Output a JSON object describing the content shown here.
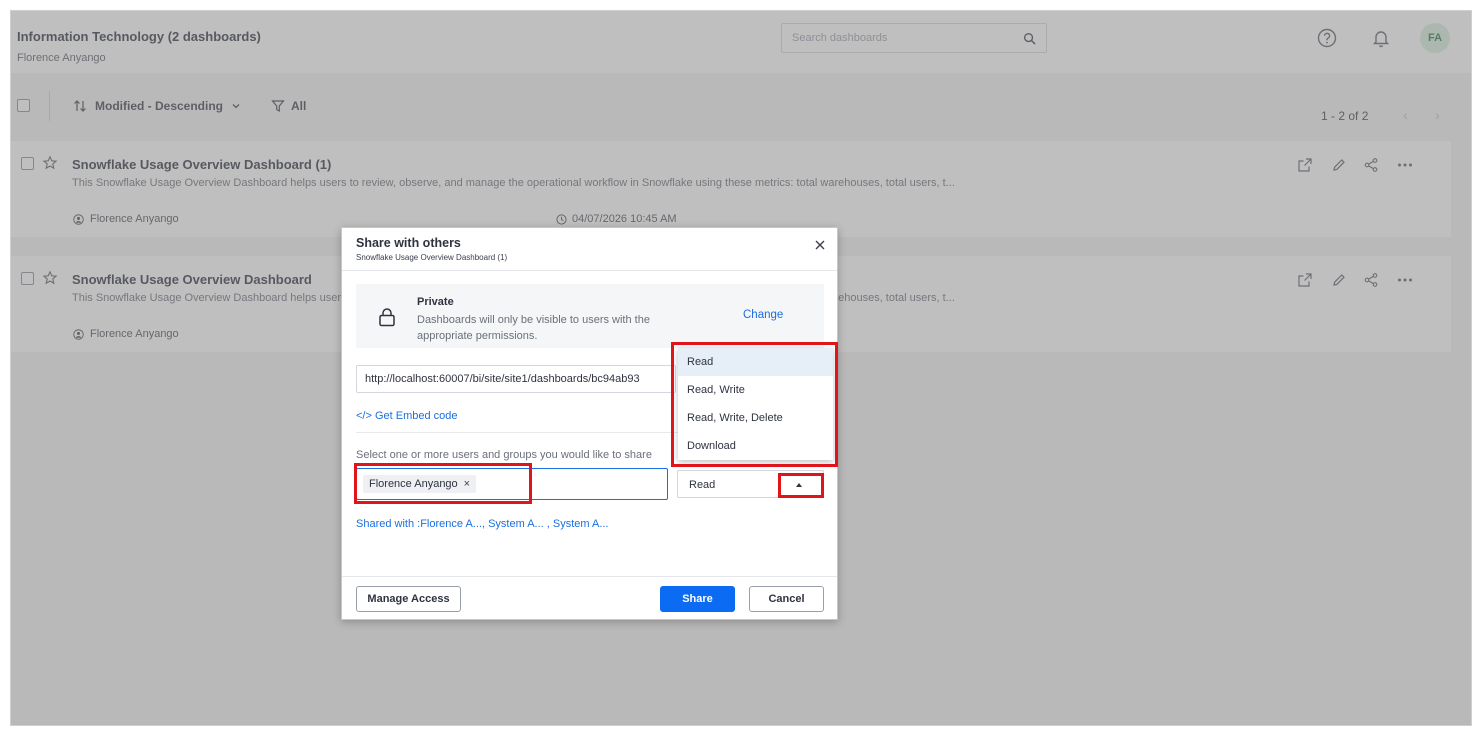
{
  "header": {
    "title": "Information Technology (2 dashboards)",
    "subtitle": "Florence Anyango",
    "search_placeholder": "Search dashboards",
    "avatar_initials": "FA"
  },
  "toolbar": {
    "sort_label": "Modified - Descending",
    "filter_label": "All",
    "pagination": "1 - 2 of 2"
  },
  "dashboards": [
    {
      "title": "Snowflake Usage Overview Dashboard (1)",
      "description": "This Snowflake Usage Overview Dashboard helps users to review, observe, and manage the operational workflow in Snowflake using these metrics: total warehouses, total users, t...",
      "owner": "Florence Anyango",
      "modified": "04/07/2026 10:45 AM"
    },
    {
      "title": "Snowflake Usage Overview Dashboard",
      "description": "This Snowflake Usage Overview Dashboard helps users to review, observe, and manage the operational workflow in Snowflake using these metrics: total warehouses, total users, t...",
      "owner": "Florence Anyango"
    }
  ],
  "share_dialog": {
    "title": "Share with others",
    "subtitle": "Snowflake Usage Overview Dashboard (1)",
    "private_title": "Private",
    "private_description": "Dashboards will only be visible to users with the appropriate permissions.",
    "change_label": "Change",
    "url": "http://localhost:60007/bi/site/site1/dashboards/bc94ab93",
    "embed_label": "</> Get Embed code",
    "select_label": "Select one or more users and groups you would like to share",
    "selected_user": "Florence Anyango",
    "permission_value": "Read",
    "permission_options": [
      "Read",
      "Read, Write",
      "Read, Write, Delete",
      "Download"
    ],
    "shared_with": "Shared with :Florence A..., System A...  , System A...",
    "manage_access_label": "Manage Access",
    "share_label": "Share",
    "cancel_label": "Cancel"
  },
  "colors": {
    "accent": "#0b6bf2",
    "link": "#1a6fe0",
    "highlight": "#e0151b",
    "avatar_bg": "#d8f0df"
  }
}
